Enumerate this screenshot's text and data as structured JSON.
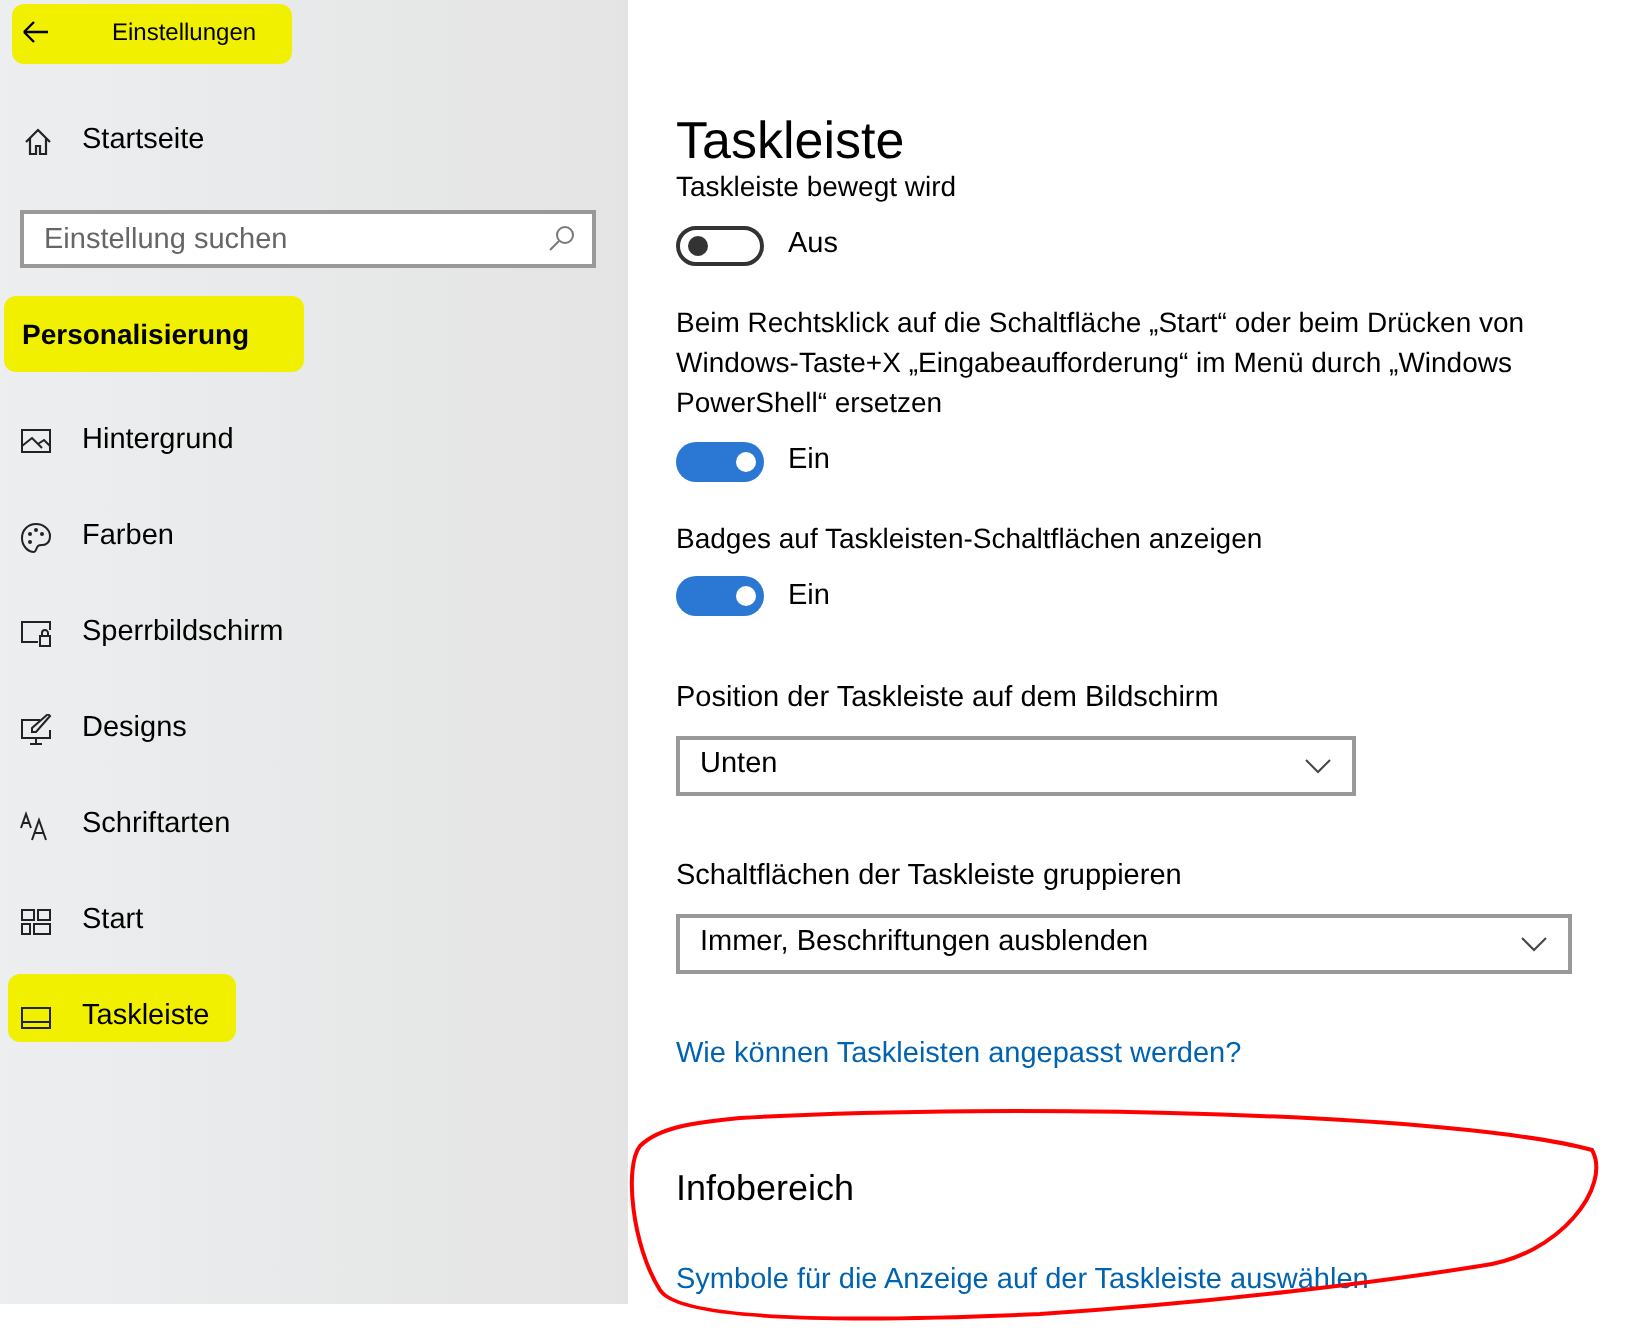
{
  "window": {
    "title": "Einstellungen"
  },
  "sidebar": {
    "home": "Startseite",
    "search": {
      "placeholder": "Einstellung suchen"
    },
    "section": "Personalisierung",
    "items": [
      {
        "label": "Hintergrund",
        "selected": false
      },
      {
        "label": "Farben",
        "selected": false
      },
      {
        "label": "Sperrbildschirm",
        "selected": false
      },
      {
        "label": "Designs",
        "selected": false
      },
      {
        "label": "Schriftarten",
        "selected": false
      },
      {
        "label": "Start",
        "selected": false
      },
      {
        "label": "Taskleiste",
        "selected": true
      }
    ]
  },
  "main": {
    "title": "Taskleiste",
    "settings": [
      {
        "kind": "toggle",
        "label": "Taskleiste bewegt wird",
        "on": false,
        "state_text": "Aus"
      },
      {
        "kind": "toggle",
        "label": "Beim Rechtsklick auf die Schaltfläche „Start“ oder beim Drücken von Windows-Taste+X „Eingabeaufforderung“ im Menü durch „Windows PowerShell“ ersetzen",
        "on": true,
        "state_text": "Ein"
      },
      {
        "kind": "toggle",
        "label": "Badges auf Taskleisten-Schaltflächen anzeigen",
        "on": true,
        "state_text": "Ein"
      },
      {
        "kind": "dropdown",
        "label": "Position der Taskleiste auf dem Bildschirm",
        "value": "Unten"
      },
      {
        "kind": "dropdown",
        "label": "Schaltflächen der Taskleiste gruppieren",
        "value": "Immer, Beschriftungen ausblenden"
      },
      {
        "kind": "link",
        "text": "Wie können Taskleisten angepasst werden?"
      },
      {
        "kind": "heading",
        "text": "Infobereich"
      },
      {
        "kind": "link",
        "text": "Symbole für die Anzeige auf der Taskleiste auswählen"
      }
    ]
  }
}
